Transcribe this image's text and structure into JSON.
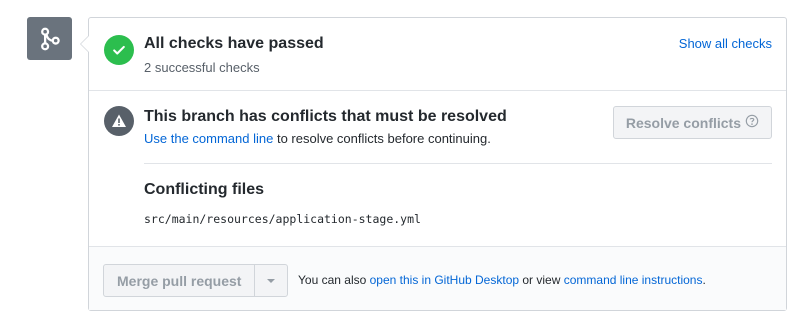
{
  "checks": {
    "title": "All checks have passed",
    "subtitle": "2 successful checks",
    "show_all_label": "Show all checks"
  },
  "conflicts": {
    "title": "This branch has conflicts that must be resolved",
    "link_text": "Use the command line",
    "desc_rest": " to resolve conflicts before continuing.",
    "resolve_button_label": "Resolve conflicts",
    "files_title": "Conflicting files",
    "files": [
      "src/main/resources/application-stage.yml"
    ]
  },
  "merge": {
    "button_label": "Merge pull request",
    "text_1": "You can also ",
    "link_desktop": "open this in GitHub Desktop",
    "text_2": " or view ",
    "link_cli": "command line instructions",
    "text_3": "."
  },
  "icons": {
    "branch": "git-merge-icon",
    "check": "check-icon",
    "alert": "alert-icon",
    "help": "question-circle-icon",
    "dropdown": "triangle-down-icon"
  },
  "colors": {
    "success": "#2cbe4e",
    "link": "#0366d6",
    "neutral": "#586069",
    "badge": "#6a737d"
  }
}
